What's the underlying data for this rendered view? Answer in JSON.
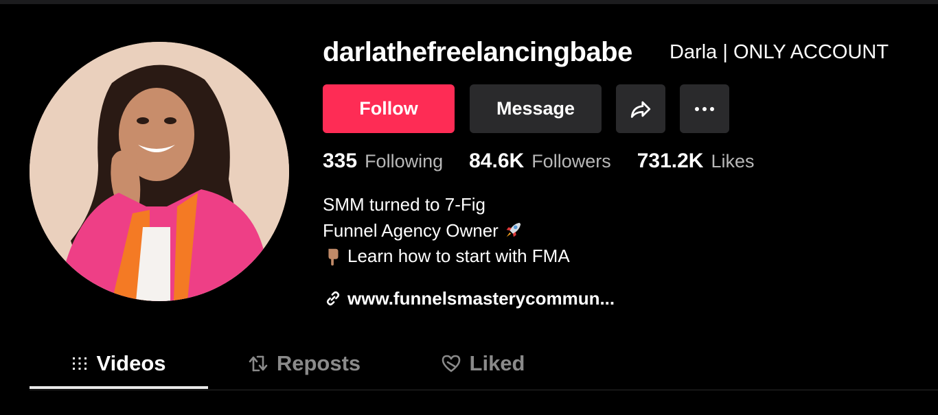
{
  "profile": {
    "username": "darlathefreelancingbabe",
    "nickname": "Darla | ONLY ACCOUNT"
  },
  "actions": {
    "follow_label": "Follow",
    "message_label": "Message",
    "share_icon": "share-arrow-icon",
    "more_icon": "more-dots-icon"
  },
  "stats": [
    {
      "value": "335",
      "label": "Following"
    },
    {
      "value": "84.6K",
      "label": "Followers"
    },
    {
      "value": "731.2K",
      "label": "Likes"
    }
  ],
  "bio": {
    "line1": "SMM turned to 7-Fig",
    "line2": "Funnel Agency Owner",
    "line2_emoji": "rocket-icon",
    "line3_emoji": "pointing-down-icon",
    "line3": "Learn how to start with FMA"
  },
  "link": {
    "text": "www.funnelsmasterycommun...",
    "icon": "link-icon"
  },
  "tabs": [
    {
      "label": "Videos",
      "icon": "grid-icon",
      "active": true
    },
    {
      "label": "Reposts",
      "icon": "repost-icon",
      "active": false
    },
    {
      "label": "Liked",
      "icon": "heart-icon",
      "active": false
    }
  ],
  "colors": {
    "background": "#000000",
    "follow_button": "#fe2c55",
    "secondary_button": "#2a2a2c",
    "muted_text": "#b8b8b8",
    "inactive_tab": "#8a8a8a"
  }
}
